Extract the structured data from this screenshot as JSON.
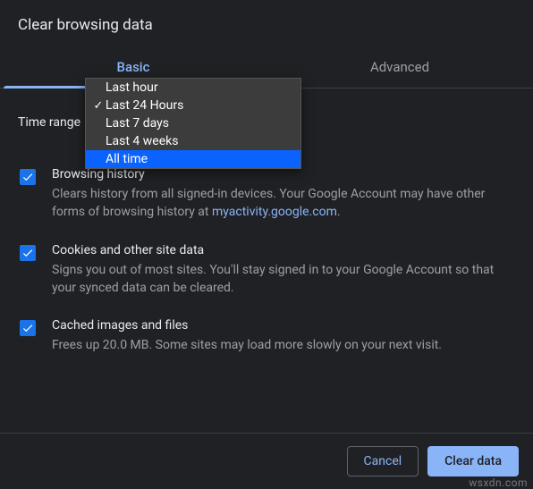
{
  "dialog": {
    "title": "Clear browsing data"
  },
  "tabs": {
    "basic": "Basic",
    "advanced": "Advanced"
  },
  "time_range": {
    "label": "Time range",
    "selected_value": "Last 24 Hours",
    "options": {
      "o0": "Last hour",
      "o1": "Last 24 Hours",
      "o2": "Last 7 days",
      "o3": "Last 4 weeks",
      "o4": "All time"
    }
  },
  "items": {
    "browsing": {
      "title": "Browsing history",
      "desc_prefix": "Clears history from all signed-in devices. Your Google Account may have other forms of browsing history at ",
      "link_text": "myactivity.google.com",
      "desc_suffix": "."
    },
    "cookies": {
      "title": "Cookies and other site data",
      "desc": "Signs you out of most sites. You'll stay signed in to your Google Account so that your synced data can be cleared."
    },
    "cache": {
      "title": "Cached images and files",
      "desc": "Frees up 20.0 MB. Some sites may load more slowly on your next visit."
    }
  },
  "buttons": {
    "cancel": "Cancel",
    "clear": "Clear data"
  },
  "watermark": "wsxdn.com"
}
